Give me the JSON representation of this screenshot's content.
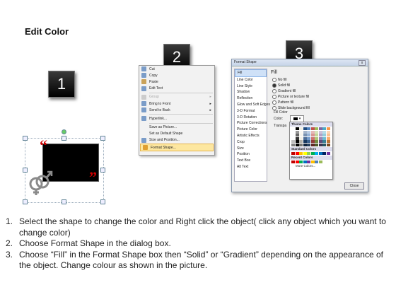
{
  "title": "Edit Color",
  "steps": [
    "1",
    "2",
    "3"
  ],
  "context_menu": {
    "items": [
      {
        "label": "Cut",
        "icon": "scissors-icon"
      },
      {
        "label": "Copy",
        "icon": "copy-icon"
      },
      {
        "label": "Paste",
        "icon": "paste-icon"
      },
      {
        "label": "Edit Text",
        "icon": "edit-text-icon"
      },
      {
        "label": "Group",
        "icon": "group-icon",
        "disabled": true,
        "submenu": true
      },
      {
        "label": "Bring to Front",
        "icon": "bring-front-icon",
        "submenu": true
      },
      {
        "label": "Send to Back",
        "icon": "send-back-icon",
        "submenu": true
      },
      {
        "label": "Hyperlink...",
        "icon": "hyperlink-icon"
      },
      {
        "label": "Save as Picture...",
        "icon": ""
      },
      {
        "label": "Set as Default Shape",
        "icon": ""
      },
      {
        "label": "Size and Position...",
        "icon": "size-icon"
      },
      {
        "label": "Format Shape...",
        "icon": "format-shape-icon",
        "highlighted": true
      }
    ]
  },
  "dialog": {
    "title": "Format Shape",
    "close_glyph": "x",
    "categories": [
      "Fill",
      "Line Color",
      "Line Style",
      "Shadow",
      "Reflection",
      "Glow and Soft Edges",
      "3-D Format",
      "3-D Rotation",
      "Picture Corrections",
      "Picture Color",
      "Artistic Effects",
      "Crop",
      "Size",
      "Position",
      "Text Box",
      "Alt Text"
    ],
    "fill_heading": "Fill",
    "fill_options": [
      "No fill",
      "Solid fill",
      "Gradient fill",
      "Picture or texture fill",
      "Pattern fill",
      "Slide background fill"
    ],
    "fill_color_label": "Fill Color",
    "color_label": "Color:",
    "transparency_label": "Transpa",
    "theme_colors_label": "Theme Colors",
    "standard_colors_label": "Standard Colors",
    "recent_colors_label": "Recent Colors",
    "more_colors_label": "More Colors...",
    "close_button": "Close",
    "theme_colors": [
      "#ffffff",
      "#000000",
      "#eeece1",
      "#1f497d",
      "#4f81bd",
      "#c0504d",
      "#9bbb59",
      "#8064a2",
      "#4bacc6",
      "#f79646"
    ],
    "standard_colors": [
      "#c00000",
      "#ff0000",
      "#ffc000",
      "#ffff00",
      "#92d050",
      "#00b050",
      "#00b0f0",
      "#0070c0",
      "#002060",
      "#7030a0"
    ],
    "recent_colors": [
      "#c00000",
      "#ff0000",
      "#00b050",
      "#0070c0",
      "#7030a0",
      "#ffc000",
      "#4f81bd",
      "#9bbb59"
    ]
  },
  "instructions": [
    {
      "n": "1.",
      "text": "Select the shape to change the color and Right click the object( click any object which you want to change color)"
    },
    {
      "n": "2.",
      "text": "Choose Format Shape in the dialog box."
    },
    {
      "n": "3.",
      "text": "Choose “Fill” in the Format Shape box then “Solid” or “Gradient” depending on the appearance of the object. Change colour as shown in the picture."
    }
  ]
}
